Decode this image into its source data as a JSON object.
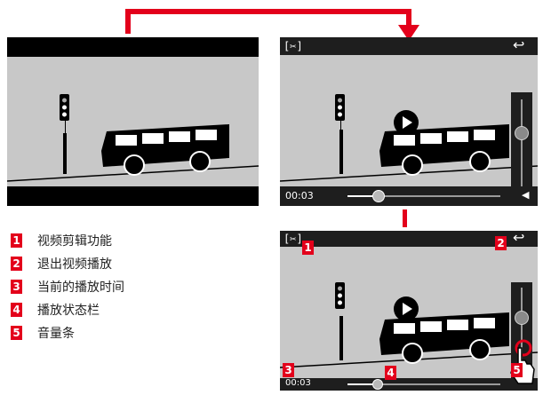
{
  "legend": [
    {
      "num": "1",
      "label": "视频剪辑功能"
    },
    {
      "num": "2",
      "label": "退出视频播放"
    },
    {
      "num": "3",
      "label": "当前的播放时间"
    },
    {
      "num": "4",
      "label": "播放状态栏"
    },
    {
      "num": "5",
      "label": "音量条"
    }
  ],
  "playback": {
    "time": "00:03",
    "progress": 0.2
  },
  "icons": {
    "cut": "[✂]",
    "back": "↩"
  },
  "colors": {
    "accent": "#e3001b",
    "screen_bg": "#c8c8c8",
    "bar_bg": "#1e1e1e"
  }
}
